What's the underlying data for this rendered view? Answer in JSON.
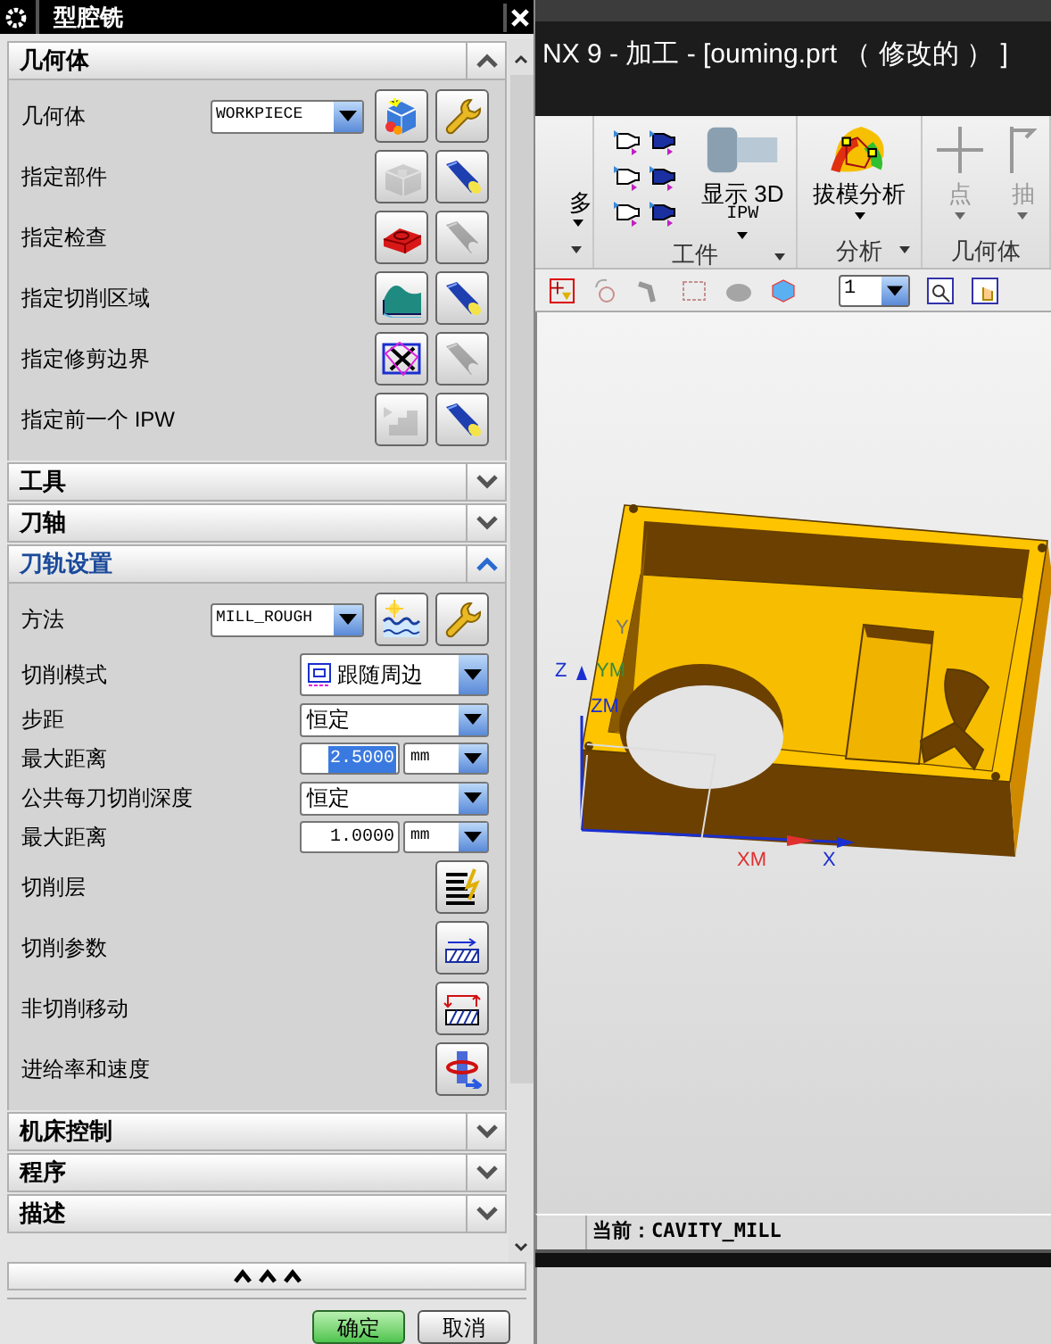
{
  "dialog": {
    "title": "型腔铣",
    "sections": [
      {
        "title": "几何体",
        "expanded": true,
        "selected": false,
        "rows": [
          {
            "kind": "select_buttons",
            "label": "几何体",
            "value": "WORKPIECE",
            "buttons": [
              {
                "kind": "geometry",
                "disabled": false
              },
              {
                "kind": "wrench",
                "disabled": false
              }
            ]
          },
          {
            "kind": "buttons",
            "label": "指定部件",
            "buttons": [
              {
                "kind": "part",
                "disabled": true
              },
              {
                "kind": "flashlight",
                "disabled": false
              }
            ]
          },
          {
            "kind": "buttons",
            "label": "指定检查",
            "buttons": [
              {
                "kind": "check",
                "disabled": false
              },
              {
                "kind": "flashlight",
                "disabled": true
              }
            ]
          },
          {
            "kind": "buttons",
            "label": "指定切削区域",
            "buttons": [
              {
                "kind": "area",
                "disabled": false
              },
              {
                "kind": "flashlight",
                "disabled": false
              }
            ]
          },
          {
            "kind": "buttons",
            "label": "指定修剪边界",
            "buttons": [
              {
                "kind": "trim",
                "disabled": false
              },
              {
                "kind": "flashlight",
                "disabled": true
              }
            ]
          },
          {
            "kind": "buttons",
            "label": "指定前一个 IPW",
            "buttons": [
              {
                "kind": "ipw",
                "disabled": true
              },
              {
                "kind": "flashlight",
                "disabled": false
              }
            ]
          }
        ]
      },
      {
        "title": "工具",
        "expanded": false,
        "selected": false
      },
      {
        "title": "刀轴",
        "expanded": false,
        "selected": false
      },
      {
        "title": "刀轨设置",
        "expanded": true,
        "selected": true,
        "rows": [
          {
            "kind": "select_buttons",
            "label": "方法",
            "value": "MILL_ROUGH",
            "buttons": [
              {
                "kind": "method",
                "disabled": false
              },
              {
                "kind": "wrench",
                "disabled": false
              }
            ]
          },
          {
            "kind": "select_icon",
            "label": "切削模式",
            "value": "跟随周边"
          },
          {
            "kind": "select",
            "label": "步距",
            "value": "恒定"
          },
          {
            "kind": "number_unit",
            "label": "最大距离",
            "value": "2.5000",
            "unit": "mm",
            "focused": true
          },
          {
            "kind": "select",
            "label": "公共每刀切削深度",
            "value": "恒定"
          },
          {
            "kind": "number_unit",
            "label": "最大距离",
            "value": "1.0000",
            "unit": "mm",
            "focused": false
          },
          {
            "kind": "buttons",
            "label": "切削层",
            "buttons": [
              {
                "kind": "layers",
                "disabled": false
              }
            ]
          },
          {
            "kind": "buttons",
            "label": "切削参数",
            "buttons": [
              {
                "kind": "params",
                "disabled": false
              }
            ]
          },
          {
            "kind": "buttons",
            "label": "非切削移动",
            "buttons": [
              {
                "kind": "noncut",
                "disabled": false
              }
            ]
          },
          {
            "kind": "buttons",
            "label": "进给率和速度",
            "buttons": [
              {
                "kind": "feeds",
                "disabled": false
              }
            ]
          }
        ]
      },
      {
        "title": "机床控制",
        "expanded": false,
        "selected": false
      },
      {
        "title": "程序",
        "expanded": false,
        "selected": false
      },
      {
        "title": "描述",
        "expanded": false,
        "selected": false
      }
    ],
    "footer_buttons": [
      {
        "label": "确定",
        "default": true
      },
      {
        "label": "取消",
        "default": false
      }
    ]
  },
  "app": {
    "title": "NX 9 - 加工 - [ouming.prt （ 修改的 ） ]",
    "ribbon": [
      {
        "items": [
          {
            "kind": "partial",
            "label": "多",
            "disabled": false
          }
        ],
        "menu": true
      },
      {
        "label": "工件",
        "items": [
          {
            "kind": "flags",
            "disabled": false
          },
          {
            "kind": "tool",
            "label": "显示 3D",
            "sublabel": "IPW",
            "disabled": false
          }
        ],
        "menu": true
      },
      {
        "label": "分析",
        "items": [
          {
            "kind": "draft",
            "label": "拔模分析",
            "disabled": false
          }
        ],
        "menu": true
      },
      {
        "label": "几何体",
        "items": [
          {
            "kind": "point",
            "label": "点",
            "disabled": true
          },
          {
            "kind": "extract",
            "label": "抽",
            "disabled": true
          }
        ],
        "menu": false
      }
    ],
    "layer_select": {
      "value": "1"
    },
    "viewport": {
      "axis_labels": [
        {
          "kind": "y",
          "text": "Y"
        },
        {
          "kind": "z",
          "text": "Z"
        },
        {
          "kind": "ym",
          "text": "YM"
        },
        {
          "kind": "zm",
          "text": "ZM"
        },
        {
          "kind": "xm",
          "text": "XM"
        },
        {
          "kind": "x",
          "text": "X"
        }
      ]
    },
    "status_bar": {
      "text": "当前：CAVITY_MILL"
    }
  }
}
